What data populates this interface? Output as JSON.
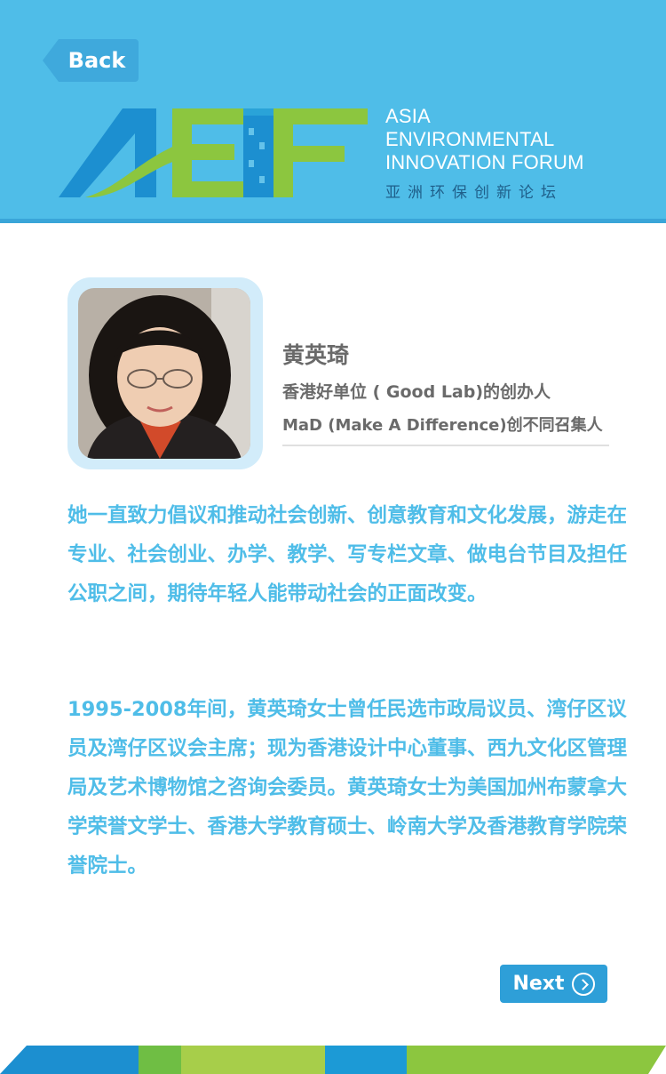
{
  "header": {
    "back_label": "Back",
    "logo_lines": [
      "ASIA",
      "ENVIRONMENTAL",
      "INNOVATION FORUM"
    ],
    "logo_cn": "亚洲环保创新论坛",
    "colors": {
      "bar": "#4fbde8",
      "button": "#3fa9dc"
    }
  },
  "profile": {
    "name": "黄英琦",
    "role1": "香港好单位 ( Good  Lab)的创办人",
    "role2": "MaD (Make A Difference)创不同召集人"
  },
  "bio": {
    "para1": "她一直致力倡议和推动社会创新、创意教育和文化发展，游走在专业、社会创业、办学、教学、写专栏文章、做电台节目及担任公职之间，期待年轻人能带动社会的正面改变。",
    "para2": "1995-2008年间，黄英琦女士曾任民选市政局议员、湾仔区议员及湾仔区议会主席；现为香港设计中心董事、西九文化区管理局及艺术博物馆之咨询会委员。黄英琦女士为美国加州布蒙拿大学荣誉文学士、香港大学教育硕士、岭南大学及香港教育学院荣誉院士。"
  },
  "footer_nav": {
    "next_label": "Next",
    "next_icon": "chevron-right-circle-icon"
  }
}
